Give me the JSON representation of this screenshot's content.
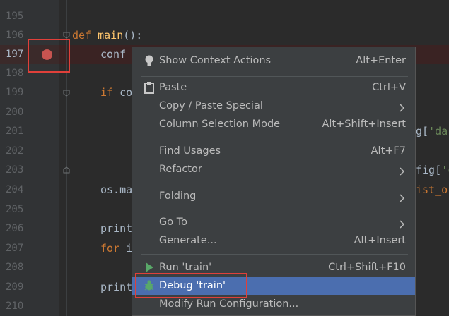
{
  "editor": {
    "line_numbers": [
      "195",
      "196",
      "197",
      "198",
      "199",
      "200",
      "201",
      "202",
      "203",
      "204",
      "205",
      "206",
      "207",
      "208",
      "209",
      "210"
    ],
    "active_line": "197",
    "code": {
      "l196_def": "def ",
      "l196_name": "main",
      "l196_rest": "():",
      "l197": "conf",
      "l199_if": "if ",
      "l199_rest": "co",
      "l201_tail": "g['da",
      "l203_tail": "fig['c",
      "l204": "os.ma",
      "l204_tail": "ist_o",
      "l206": "print",
      "l207_for": "for ",
      "l207_rest": "i",
      "l209": "print"
    }
  },
  "context_menu": {
    "items": [
      {
        "label": "Show Context Actions",
        "shortcut": "Alt+Enter",
        "icon": "lightbulb-icon"
      },
      {
        "label": "Paste",
        "shortcut": "Ctrl+V",
        "icon": "clipboard-icon"
      },
      {
        "label": "Copy / Paste Special",
        "submenu": true
      },
      {
        "label": "Column Selection Mode",
        "shortcut": "Alt+Shift+Insert"
      },
      {
        "label": "Find Usages",
        "shortcut": "Alt+F7"
      },
      {
        "label": "Refactor",
        "submenu": true
      },
      {
        "label": "Folding",
        "submenu": true
      },
      {
        "label": "Go To",
        "submenu": true
      },
      {
        "label": "Generate...",
        "shortcut": "Alt+Insert"
      },
      {
        "label": "Run 'train'",
        "shortcut": "Ctrl+Shift+F10",
        "icon": "run-icon"
      },
      {
        "label": "Debug 'train'",
        "selected": true,
        "icon": "debug-icon"
      },
      {
        "label": "Modify Run Configuration..."
      }
    ]
  },
  "colors": {
    "background": "#2b2b2b",
    "menu_background": "#3c3f41",
    "selection": "#4b6eaf",
    "breakpoint": "#c75450",
    "annotation": "#e0403a"
  }
}
